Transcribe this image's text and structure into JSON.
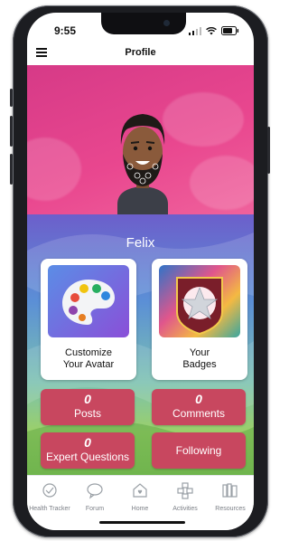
{
  "status": {
    "time": "9:55"
  },
  "header": {
    "title": "Profile"
  },
  "profile": {
    "name": "Felix"
  },
  "cards": [
    {
      "label_line1": "Customize",
      "label_line2": "Your Avatar"
    },
    {
      "label_line1": "Your",
      "label_line2": "Badges"
    }
  ],
  "stats": {
    "posts": {
      "count": "0",
      "label": "Posts"
    },
    "comments": {
      "count": "0",
      "label": "Comments"
    },
    "expert_questions": {
      "count": "0",
      "label": "Expert Questions"
    },
    "following": {
      "label": "Following"
    }
  },
  "tabs": [
    {
      "label": "Health Tracker",
      "icon": "health-tracker-icon"
    },
    {
      "label": "Forum",
      "icon": "forum-icon"
    },
    {
      "label": "Home",
      "icon": "home-icon"
    },
    {
      "label": "Activities",
      "icon": "activities-icon"
    },
    {
      "label": "Resources",
      "icon": "resources-icon"
    }
  ],
  "colors": {
    "banner": "#e9478f",
    "stat_button": "#c8475f"
  }
}
